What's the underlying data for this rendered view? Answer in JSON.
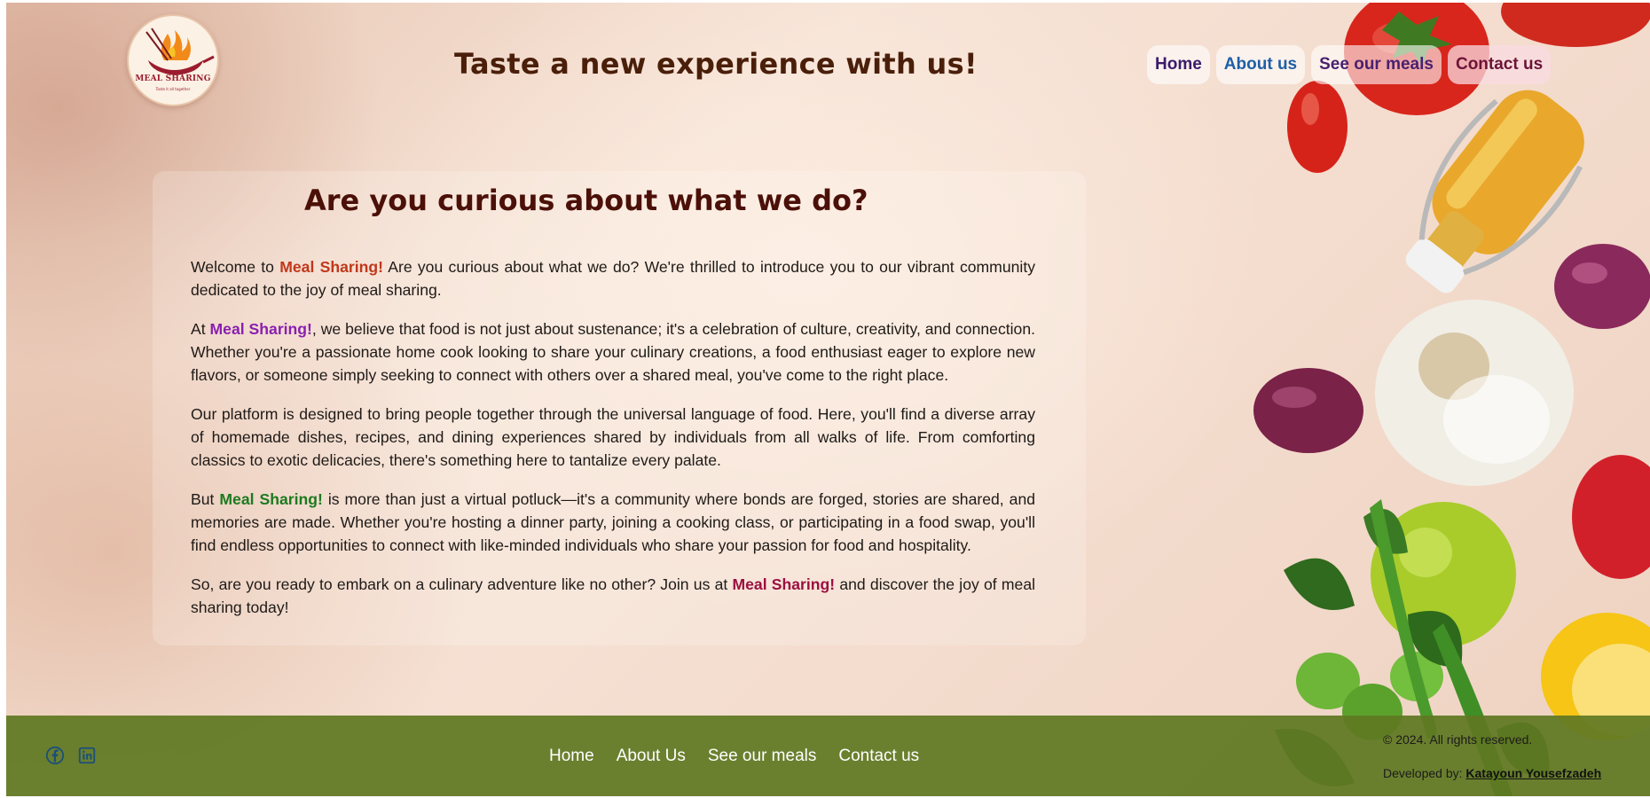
{
  "header": {
    "logo_text": "MEAL SHARING",
    "logo_sub": "Taste it all together",
    "tagline": "Taste a new experience with us!"
  },
  "nav": {
    "home": "Home",
    "about": "About us",
    "meals": "See our meals",
    "contact": "Contact us"
  },
  "main": {
    "heading": "Are you curious about what we do?",
    "brand": "Meal Sharing!",
    "p1_start": "Welcome to ",
    "p1_end": " Are you curious about what we do? We're thrilled to introduce you to our vibrant community dedicated to the joy of meal sharing.",
    "p2_start": "At ",
    "p2_end": ", we believe that food is not just about sustenance; it's a celebration of culture, creativity, and connection. Whether you're a passionate home cook looking to share your culinary creations, a food enthusiast eager to explore new flavors, or someone simply seeking to connect with others over a shared meal, you've come to the right place.",
    "p3": "Our platform is designed to bring people together through the universal language of food. Here, you'll find a diverse array of homemade dishes, recipes, and dining experiences shared by individuals from all walks of life. From comforting classics to exotic delicacies, there's something here to tantalize every palate.",
    "p4_start": "But ",
    "p4_end": " is more than just a virtual potluck—it's a community where bonds are forged, stories are shared, and memories are made. Whether you're hosting a dinner party, joining a cooking class, or participating in a food swap, you'll find endless opportunities to connect with like-minded individuals who share your passion for food and hospitality.",
    "p5_start": "So, are you ready to embark on a culinary adventure like no other? Join us at ",
    "p5_end": " and discover the joy of meal sharing today!"
  },
  "footer": {
    "social": [
      "facebook-icon",
      "linkedin-icon"
    ],
    "links": {
      "home": "Home",
      "about": "About Us",
      "meals": "See our meals",
      "contact": "Contact us"
    },
    "copyright": "© 2024. All rights reserved.",
    "developed_label": "Developed by: ",
    "developer": "Katayoun Yousefzadeh"
  },
  "colors": {
    "footer_bg": "#607822",
    "heading": "#4b1008",
    "brand_1": "#c0381b",
    "brand_2": "#8a1fb0",
    "brand_3": "#1d7a20",
    "brand_4": "#9b1040"
  }
}
